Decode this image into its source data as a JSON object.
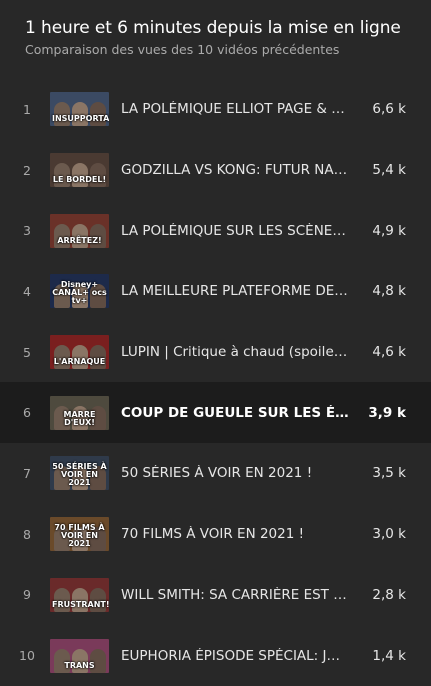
{
  "header": {
    "title": "1 heure et 6 minutes depuis la mise en ligne",
    "subtitle": "Comparaison des vues des 10 vidéos précédentes"
  },
  "videos": [
    {
      "rank": "1",
      "title": "LA POLÉMIQUE ELLIOT PAGE & TRANSGENRE",
      "views": "6,6 k",
      "thumb_caption": "INSUPPORTABLE",
      "thumb_color": "#3b4a63",
      "highlight": false
    },
    {
      "rank": "2",
      "title": "GODZILLA VS KONG: FUTUR NANAR ?",
      "views": "5,4 k",
      "thumb_caption": "LE BORDEL!",
      "thumb_color": "#4a3a32",
      "highlight": false
    },
    {
      "rank": "3",
      "title": "LA POLÉMIQUE SUR LES SCÈNES DE SEXE",
      "views": "4,9 k",
      "thumb_caption": "ARRÊTEZ!",
      "thumb_color": "#6a3128",
      "highlight": false
    },
    {
      "rank": "4",
      "title": "LA MEILLEURE PLATEFORME DE STREAMING",
      "views": "4,8 k",
      "thumb_caption": "Disney+ CANAL+ ocs tv+",
      "thumb_color": "#1d2a4a",
      "highlight": false
    },
    {
      "rank": "5",
      "title": "LUPIN | Critique à chaud (spoilers)",
      "views": "4,6 k",
      "thumb_caption": "L'ARNAQUE",
      "thumb_color": "#7a1f1f",
      "highlight": false
    },
    {
      "rank": "6",
      "title": "COUP DE GUEULE SUR LES ÉLITES",
      "views": "3,9 k",
      "thumb_caption": "MARRE D'EUX!",
      "thumb_color": "#4e4a3e",
      "highlight": true
    },
    {
      "rank": "7",
      "title": "50 SÉRIES À VOIR EN 2021 !",
      "views": "3,5 k",
      "thumb_caption": "50 SÉRIES À VOIR EN 2021",
      "thumb_color": "#2f3a4a",
      "highlight": false
    },
    {
      "rank": "8",
      "title": "70 FILMS À VOIR EN 2021 !",
      "views": "3,0 k",
      "thumb_caption": "70 FILMS À VOIR EN 2021",
      "thumb_color": "#6a4a2a",
      "highlight": false
    },
    {
      "rank": "9",
      "title": "WILL SMITH: SA CARRIÈRE EST FINIE ?",
      "views": "2,8 k",
      "thumb_caption": "FRUSTRANT!",
      "thumb_color": "#6a2a2a",
      "highlight": false
    },
    {
      "rank": "10",
      "title": "EUPHORIA ÉPISODE SPÉCIAL: JULES",
      "views": "1,4 k",
      "thumb_caption": "TRANS",
      "thumb_color": "#7a3a5a",
      "highlight": false
    }
  ]
}
